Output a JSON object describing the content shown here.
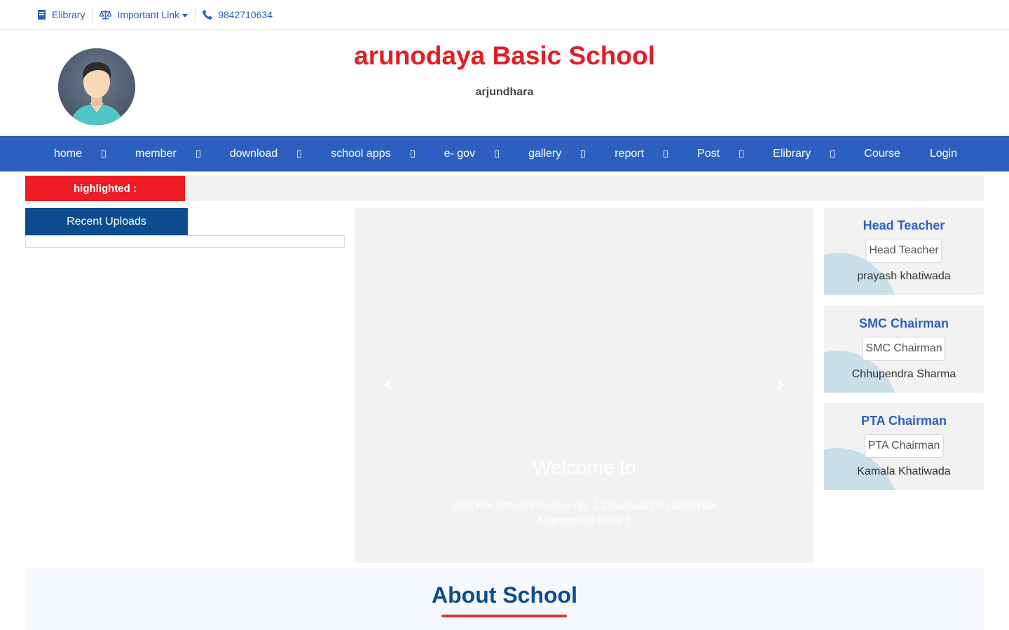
{
  "topbar": {
    "elibrary_label": "Elibrary",
    "important_link_label": "Important Link",
    "phone": "9842710634"
  },
  "header": {
    "school_name": "arunodaya Basic School",
    "subtitle": "arjundhara"
  },
  "nav": {
    "items": [
      {
        "label": "home",
        "dropdown": true
      },
      {
        "label": "member",
        "dropdown": true
      },
      {
        "label": "download",
        "dropdown": true
      },
      {
        "label": "school apps",
        "dropdown": true
      },
      {
        "label": "e- gov",
        "dropdown": true
      },
      {
        "label": "gallery",
        "dropdown": true
      },
      {
        "label": "report",
        "dropdown": true
      },
      {
        "label": "Post",
        "dropdown": true
      },
      {
        "label": "Elibrary",
        "dropdown": true
      },
      {
        "label": "Course",
        "dropdown": false
      },
      {
        "label": "Login",
        "dropdown": false
      }
    ]
  },
  "highlight": {
    "label": "highlighted :"
  },
  "recent_uploads": {
    "tab_label": "Recent Uploads"
  },
  "carousel": {
    "title": "Welcome to",
    "description": "Dalit Pra School Province No. 1 Dhankuta (07) Dhankuta Nagarpalika (003) 7"
  },
  "cards": [
    {
      "title": "Head Teacher",
      "image_alt": "Head Teacher",
      "name": "prayash khatiwada"
    },
    {
      "title": "SMC Chairman",
      "image_alt": "SMC Chairman",
      "name": "Chhupendra Sharma"
    },
    {
      "title": "PTA Chairman",
      "image_alt": "PTA Chairman",
      "name": "Kamala Khatiwada"
    }
  ],
  "about": {
    "title": "About School"
  },
  "colors": {
    "brand_red": "#e31e24",
    "nav_blue": "#2c5fc0",
    "dark_blue": "#0d4d8f",
    "highlight_red": "#ee1c25"
  }
}
